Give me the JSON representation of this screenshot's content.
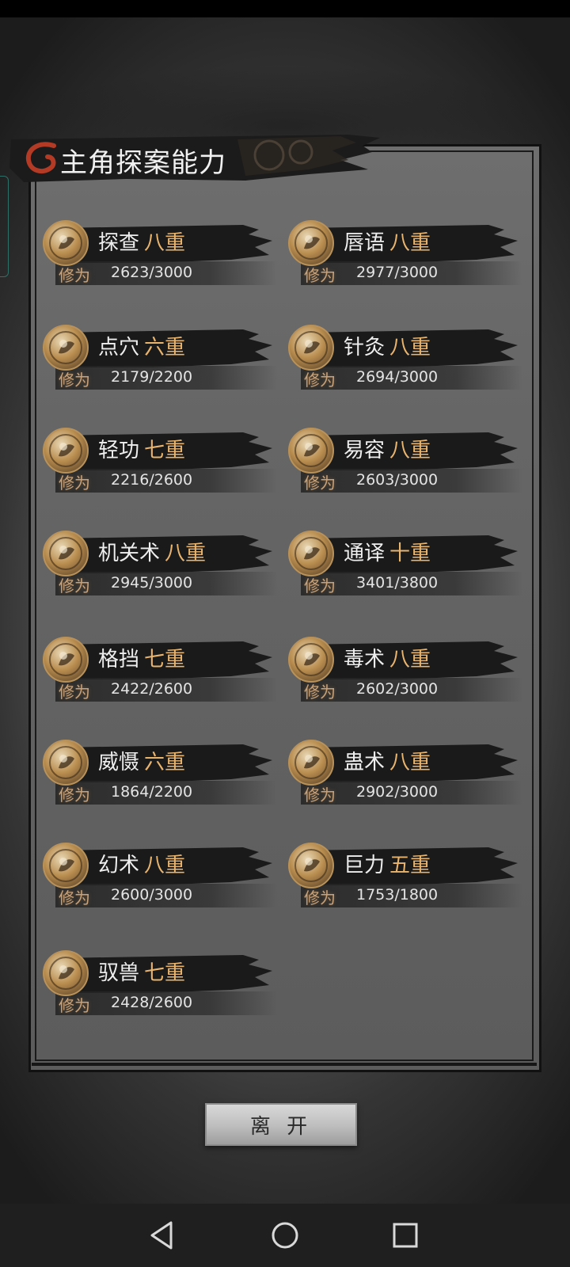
{
  "header": {
    "title": "主角探案能力"
  },
  "skills": [
    {
      "name": "探查",
      "level": "八重",
      "xp_label": "修为",
      "xp": "2623/3000",
      "icon": "investigation-icon"
    },
    {
      "name": "唇语",
      "level": "八重",
      "xp_label": "修为",
      "xp": "2977/3000",
      "icon": "lip-reading-icon"
    },
    {
      "name": "点穴",
      "level": "六重",
      "xp_label": "修为",
      "xp": "2179/2200",
      "icon": "acupoint-strike-icon"
    },
    {
      "name": "针灸",
      "level": "八重",
      "xp_label": "修为",
      "xp": "2694/3000",
      "icon": "acupuncture-icon"
    },
    {
      "name": "轻功",
      "level": "七重",
      "xp_label": "修为",
      "xp": "2216/2600",
      "icon": "lightness-skill-icon"
    },
    {
      "name": "易容",
      "level": "八重",
      "xp_label": "修为",
      "xp": "2603/3000",
      "icon": "disguise-icon"
    },
    {
      "name": "机关术",
      "level": "八重",
      "xp_label": "修为",
      "xp": "2945/3000",
      "icon": "mechanism-icon"
    },
    {
      "name": "通译",
      "level": "十重",
      "xp_label": "修为",
      "xp": "3401/3800",
      "icon": "translation-icon"
    },
    {
      "name": "格挡",
      "level": "七重",
      "xp_label": "修为",
      "xp": "2422/2600",
      "icon": "block-icon"
    },
    {
      "name": "毒术",
      "level": "八重",
      "xp_label": "修为",
      "xp": "2602/3000",
      "icon": "poison-icon"
    },
    {
      "name": "威慑",
      "level": "六重",
      "xp_label": "修为",
      "xp": "1864/2200",
      "icon": "intimidate-icon"
    },
    {
      "name": "蛊术",
      "level": "八重",
      "xp_label": "修为",
      "xp": "2902/3000",
      "icon": "gu-sorcery-icon"
    },
    {
      "name": "幻术",
      "level": "八重",
      "xp_label": "修为",
      "xp": "2600/3000",
      "icon": "illusion-icon"
    },
    {
      "name": "巨力",
      "level": "五重",
      "xp_label": "修为",
      "xp": "1753/1800",
      "icon": "great-strength-icon"
    },
    {
      "name": "驭兽",
      "level": "七重",
      "xp_label": "修为",
      "xp": "2428/2600",
      "icon": "beast-taming-icon"
    }
  ],
  "footer": {
    "leave_label": "离 开"
  },
  "navbar": {
    "back": "back-icon",
    "home": "home-icon",
    "recents": "recents-icon"
  },
  "colors": {
    "level": "#e9b46e",
    "xp_label": "#c8a27a",
    "panel": "#666666"
  }
}
